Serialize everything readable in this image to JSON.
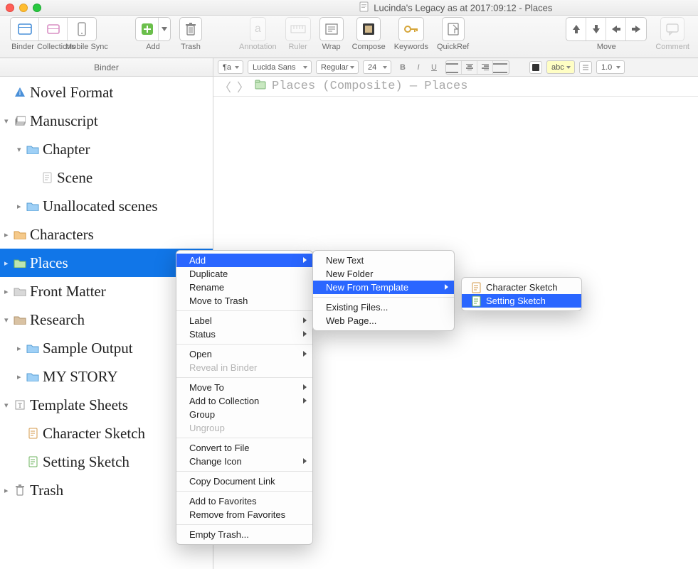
{
  "window": {
    "title": "Lucinda's Legacy as at 2017:09:12 - Places"
  },
  "toolbar": {
    "items": [
      {
        "label": "Binder"
      },
      {
        "label": "Collections"
      },
      {
        "label": "Mobile Sync"
      },
      {
        "label": "Add"
      },
      {
        "label": "Trash"
      },
      {
        "label": "Annotation"
      },
      {
        "label": "Ruler"
      },
      {
        "label": "Wrap"
      },
      {
        "label": "Compose"
      },
      {
        "label": "Keywords"
      },
      {
        "label": "QuickRef"
      },
      {
        "label": "Move"
      },
      {
        "label": "Comment"
      }
    ]
  },
  "formatbar": {
    "para": "¶a",
    "font": "Lucida Sans",
    "weight": "Regular",
    "size": "24",
    "b": "B",
    "i": "I",
    "u": "U",
    "highlight": "abc",
    "spacing": "1.0"
  },
  "sidebar": {
    "header": "Binder",
    "items": [
      {
        "label": "Novel Format",
        "level": 1,
        "icon": "info",
        "disc": ""
      },
      {
        "label": "Manuscript",
        "level": 1,
        "icon": "stack",
        "disc": "▾"
      },
      {
        "label": "Chapter",
        "level": 2,
        "icon": "folder-blue",
        "disc": "▾"
      },
      {
        "label": "Scene",
        "level": 3,
        "icon": "page",
        "disc": ""
      },
      {
        "label": "Unallocated scenes",
        "level": 2,
        "icon": "folder-blue",
        "disc": "▸"
      },
      {
        "label": "Characters",
        "level": 1,
        "icon": "folder-orange",
        "disc": "▸"
      },
      {
        "label": "Places",
        "level": 1,
        "icon": "folder-green",
        "disc": "▸",
        "selected": true
      },
      {
        "label": "Front Matter",
        "level": 1,
        "icon": "folder-gray",
        "disc": "▸"
      },
      {
        "label": "Research",
        "level": 1,
        "icon": "folder-brown",
        "disc": "▾"
      },
      {
        "label": "Sample Output",
        "level": 2,
        "icon": "folder-blue",
        "disc": "▸"
      },
      {
        "label": "MY STORY",
        "level": 2,
        "icon": "folder-blue",
        "disc": "▸"
      },
      {
        "label": "Template Sheets",
        "level": 1,
        "icon": "template",
        "disc": "▾"
      },
      {
        "label": "Character Sketch",
        "level": 2,
        "icon": "page-orange",
        "disc": ""
      },
      {
        "label": "Setting Sketch",
        "level": 2,
        "icon": "page-green",
        "disc": ""
      },
      {
        "label": "Trash",
        "level": 1,
        "icon": "trash",
        "disc": "▸"
      }
    ]
  },
  "pathbar": {
    "back": "〈",
    "fwd": "〉",
    "text": "Places (Composite) — Places"
  },
  "context_menu": {
    "items": [
      {
        "label": "Add",
        "sub": true,
        "hl": true
      },
      {
        "label": "Duplicate"
      },
      {
        "label": "Rename"
      },
      {
        "label": "Move to Trash"
      },
      {
        "sep": true
      },
      {
        "label": "Label",
        "sub": true
      },
      {
        "label": "Status",
        "sub": true
      },
      {
        "sep": true
      },
      {
        "label": "Open",
        "sub": true
      },
      {
        "label": "Reveal in Binder",
        "disabled": true
      },
      {
        "sep": true
      },
      {
        "label": "Move To",
        "sub": true
      },
      {
        "label": "Add to Collection",
        "sub": true
      },
      {
        "label": "Group"
      },
      {
        "label": "Ungroup",
        "disabled": true
      },
      {
        "sep": true
      },
      {
        "label": "Convert to File"
      },
      {
        "label": "Change Icon",
        "sub": true
      },
      {
        "sep": true
      },
      {
        "label": "Copy Document Link"
      },
      {
        "sep": true
      },
      {
        "label": "Add to Favorites"
      },
      {
        "label": "Remove from Favorites"
      },
      {
        "sep": true
      },
      {
        "label": "Empty Trash..."
      }
    ]
  },
  "submenu_add": {
    "items": [
      {
        "label": "New Text"
      },
      {
        "label": "New Folder"
      },
      {
        "label": "New From Template",
        "sub": true,
        "hl": true
      },
      {
        "sep": true
      },
      {
        "label": "Existing Files..."
      },
      {
        "label": "Web Page..."
      }
    ]
  },
  "submenu_template": {
    "items": [
      {
        "label": "Character Sketch",
        "icon": "page-orange"
      },
      {
        "label": "Setting Sketch",
        "icon": "page-green",
        "hl": true
      }
    ]
  }
}
